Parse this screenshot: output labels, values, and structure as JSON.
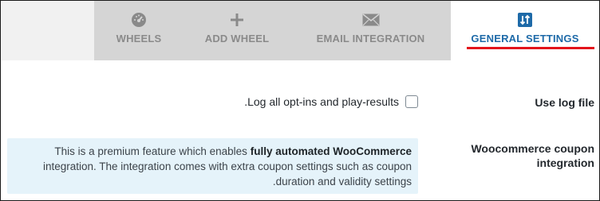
{
  "tabs": [
    {
      "label": "WHEELS",
      "icon": "dashboard-icon"
    },
    {
      "label": "ADD WHEEL",
      "icon": "plus-icon"
    },
    {
      "label": "EMAIL INTEGRATION",
      "icon": "envelope-icon"
    },
    {
      "label": "GENERAL SETTINGS",
      "icon": "sort-arrows-icon",
      "active": true
    }
  ],
  "colors": {
    "active_tab": "#1e6aa8",
    "underline": "#e3141b",
    "inactive_tab": "#8a8a8a",
    "tabbar_bg": "#d5d5d5",
    "notice_bg": "#e5f3fa"
  },
  "settings": {
    "log": {
      "label": "Use log file",
      "checkbox_text": ".Log all opt-ins and play-results",
      "checked": false
    },
    "coupon": {
      "label": "Woocommerce coupon integration",
      "notice_pre": "This is a premium feature which enables ",
      "notice_bold": "fully automated WooCommerce",
      "notice_post": " integration. The integration comes with extra coupon settings such as coupon .duration and validity settings"
    }
  }
}
